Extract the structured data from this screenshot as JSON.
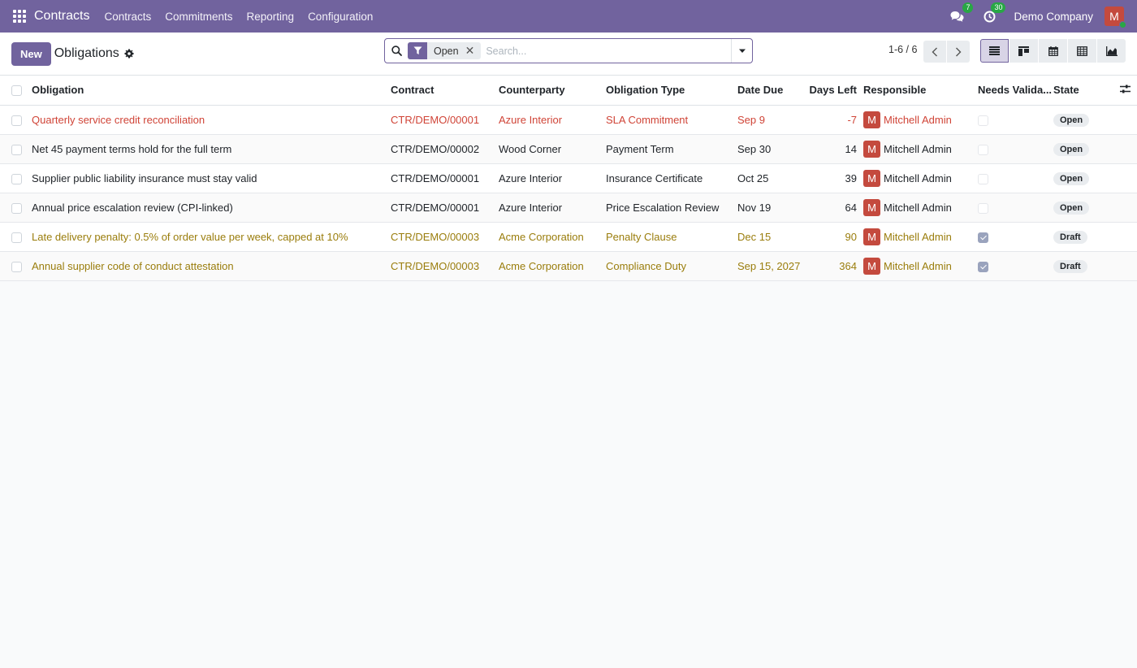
{
  "navbar": {
    "app_name": "Contracts",
    "menu": [
      "Contracts",
      "Commitments",
      "Reporting",
      "Configuration"
    ],
    "messages_count": "7",
    "activities_count": "30",
    "company": "Demo Company",
    "user_initial": "M"
  },
  "control_panel": {
    "new_label": "New",
    "title": "Obligations",
    "facet_label": "Open",
    "search_placeholder": "Search...",
    "pager": "1-6 / 6"
  },
  "table": {
    "columns": [
      "Obligation",
      "Contract",
      "Counterparty",
      "Obligation Type",
      "Date Due",
      "Days Left",
      "Responsible",
      "Needs Valida...",
      "State"
    ],
    "rows": [
      {
        "obligation": "Quarterly service credit reconciliation",
        "contract": "CTR/DEMO/00001",
        "counterparty": "Azure Interior",
        "type": "SLA Commitment",
        "date_due": "Sep 9",
        "days_left": "-7",
        "responsible_initial": "M",
        "responsible": "Mitchell Admin",
        "needs_validation": false,
        "state": "Open",
        "decoration": "danger"
      },
      {
        "obligation": "Net 45 payment terms hold for the full term",
        "contract": "CTR/DEMO/00002",
        "counterparty": "Wood Corner",
        "type": "Payment Term",
        "date_due": "Sep 30",
        "days_left": "14",
        "responsible_initial": "M",
        "responsible": "Mitchell Admin",
        "needs_validation": false,
        "state": "Open",
        "decoration": "none"
      },
      {
        "obligation": "Supplier public liability insurance must stay valid",
        "contract": "CTR/DEMO/00001",
        "counterparty": "Azure Interior",
        "type": "Insurance Certificate",
        "date_due": "Oct 25",
        "days_left": "39",
        "responsible_initial": "M",
        "responsible": "Mitchell Admin",
        "needs_validation": false,
        "state": "Open",
        "decoration": "none"
      },
      {
        "obligation": "Annual price escalation review (CPI-linked)",
        "contract": "CTR/DEMO/00001",
        "counterparty": "Azure Interior",
        "type": "Price Escalation Review",
        "date_due": "Nov 19",
        "days_left": "64",
        "responsible_initial": "M",
        "responsible": "Mitchell Admin",
        "needs_validation": false,
        "state": "Open",
        "decoration": "none"
      },
      {
        "obligation": "Late delivery penalty: 0.5% of order value per week, capped at 10%",
        "contract": "CTR/DEMO/00003",
        "counterparty": "Acme Corporation",
        "type": "Penalty Clause",
        "date_due": "Dec 15",
        "days_left": "90",
        "responsible_initial": "M",
        "responsible": "Mitchell Admin",
        "needs_validation": true,
        "state": "Draft",
        "decoration": "warning"
      },
      {
        "obligation": "Annual supplier code of conduct attestation",
        "contract": "CTR/DEMO/00003",
        "counterparty": "Acme Corporation",
        "type": "Compliance Duty",
        "date_due": "Sep 15, 2027",
        "days_left": "364",
        "responsible_initial": "M",
        "responsible": "Mitchell Admin",
        "needs_validation": true,
        "state": "Draft",
        "decoration": "warning"
      }
    ]
  },
  "colors": {
    "brand": "#71639e",
    "danger": "#d04437",
    "warning": "#9a7d0c",
    "avatar": "#c44a3e"
  }
}
